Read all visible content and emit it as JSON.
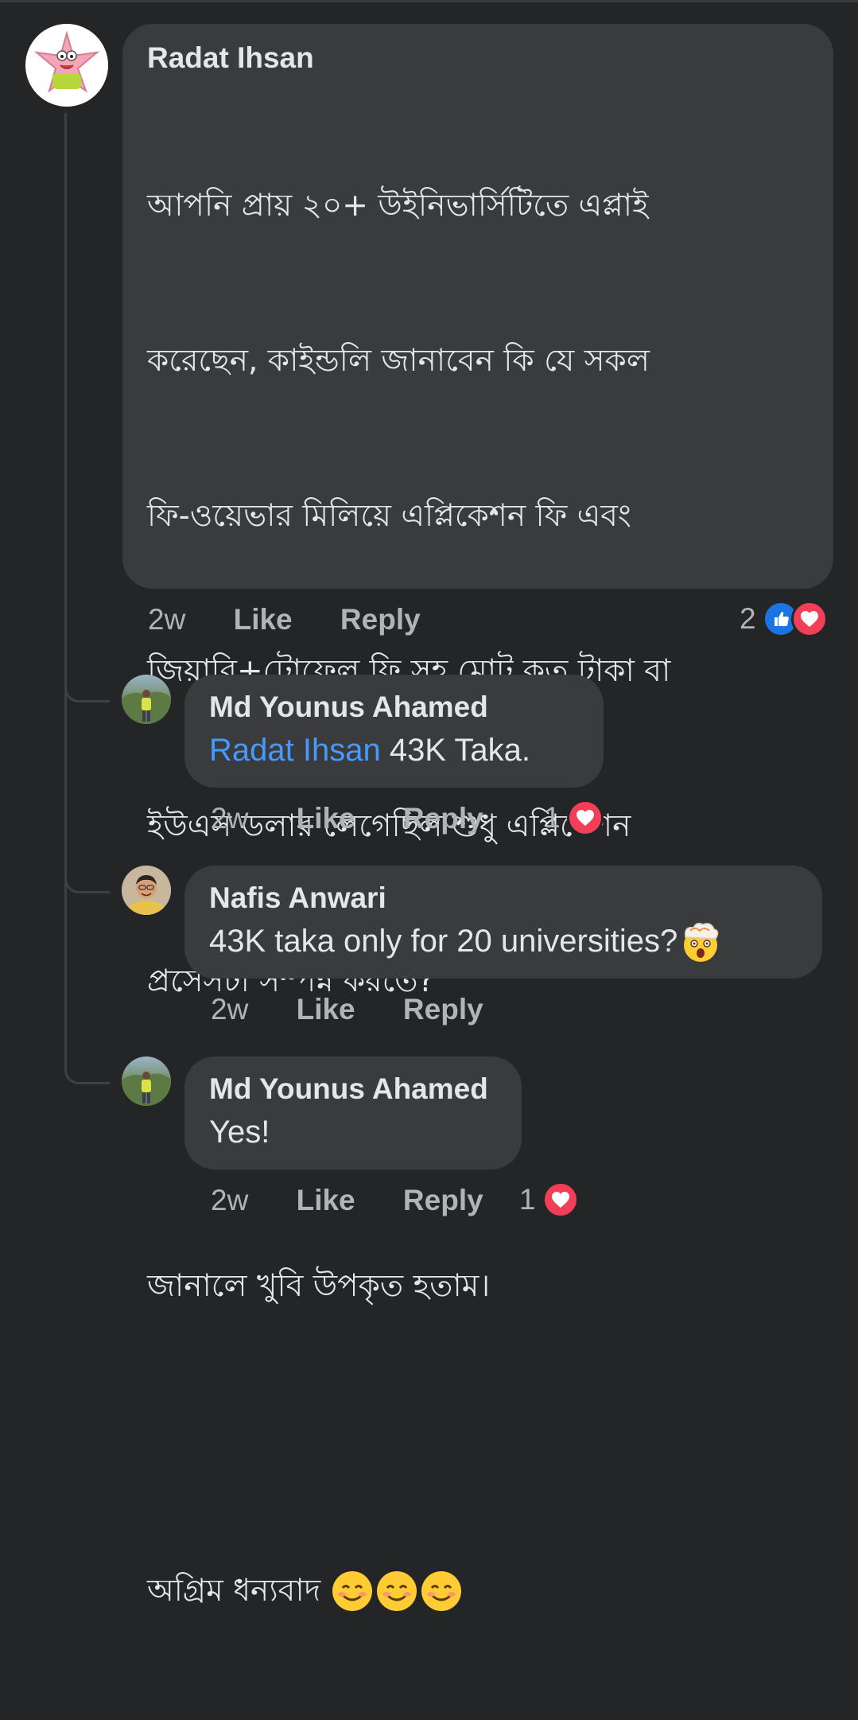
{
  "comment": {
    "author": "Radat Ihsan",
    "lines": [
      "আপনি প্রায় ২০+ উইনিভার্সিটিতে এপ্লাই",
      "করেছেন, কাইন্ডলি জানাবেন কি যে সকল",
      "ফি-ওয়েভার মিলিয়ে এপ্লিকেশন ফি এবং",
      "জিয়ারি+টোফেল ফি সহ মোট কত টাকা বা",
      "ইউএস ডলার লেগেছিল শুধু এপ্লিকেশন",
      "প্রসেসটা সম্পন্ন করতে?",
      "জানালে খুবি উপকৃত হতাম।",
      "অগ্রিম ধন্যবাদ"
    ],
    "emoji_count": 3,
    "time": "2w",
    "like": "Like",
    "reply": "Reply",
    "reaction_count": "2"
  },
  "replies": [
    {
      "author": "Md Younus Ahamed",
      "mention": "Radat Ihsan",
      "text": " 43K Taka.",
      "time": "2w",
      "like": "Like",
      "reply": "Reply",
      "reaction_count": "1"
    },
    {
      "author": "Nafis Anwari",
      "text": "43K taka only for 20 universities?",
      "time": "2w",
      "like": "Like",
      "reply": "Reply"
    },
    {
      "author": "Md Younus Ahamed",
      "text": "Yes!",
      "time": "2w",
      "like": "Like",
      "reply": "Reply",
      "reaction_count": "1"
    }
  ],
  "colors": {
    "background": "#242526",
    "bubble": "#3a3b3c",
    "mention": "#4599ff",
    "like": "#1b74e4",
    "love": "#f33e58"
  }
}
